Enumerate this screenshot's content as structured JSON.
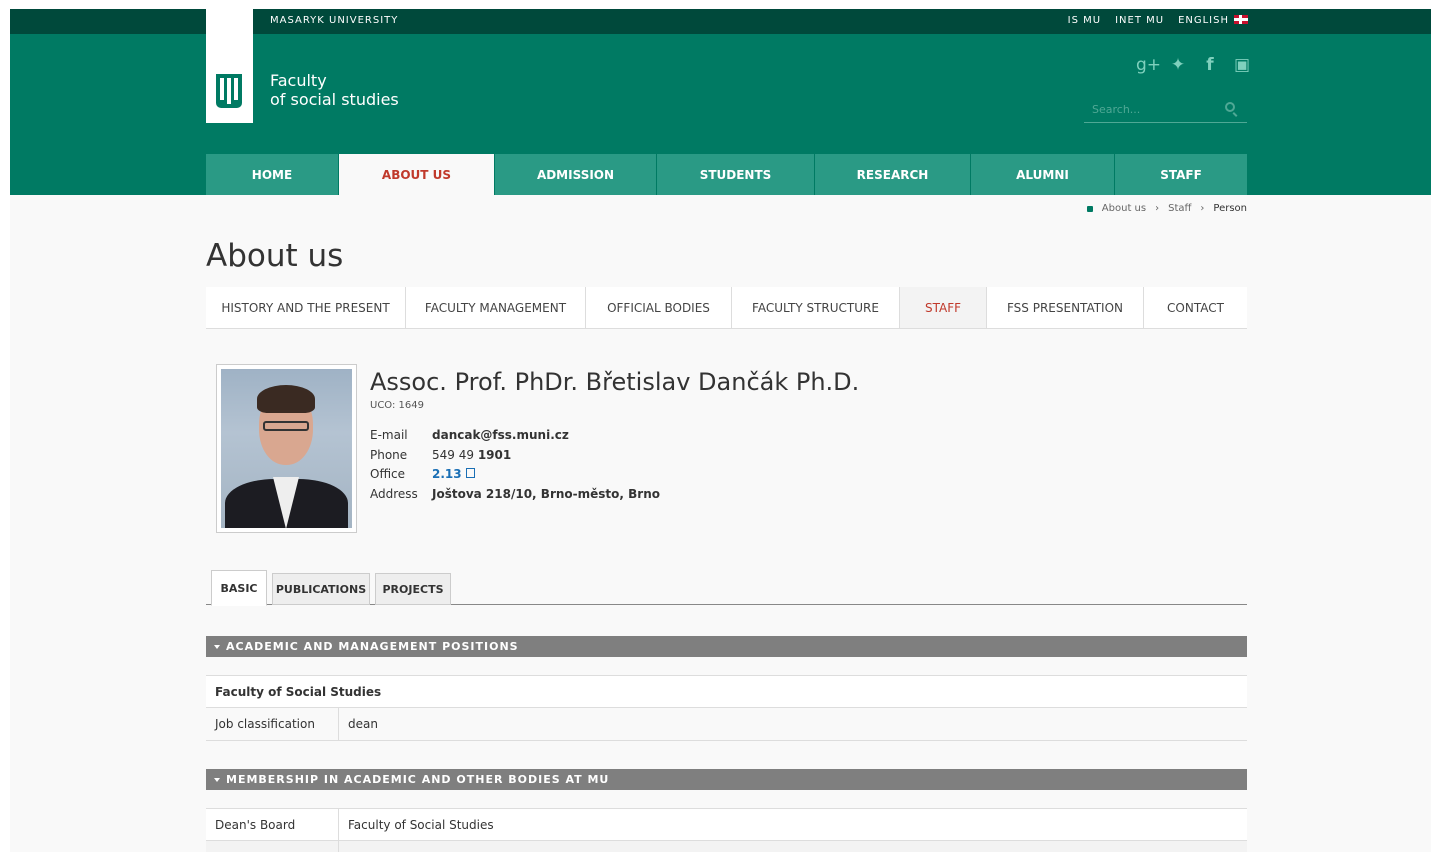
{
  "topbar": {
    "university": "MASARYK UNIVERSITY",
    "links": [
      "IS MU",
      "INET MU",
      "ENGLISH"
    ]
  },
  "header": {
    "faculty_line1": "Faculty",
    "faculty_line2": "of social studies",
    "search_placeholder": "Search..."
  },
  "social_icons": [
    "google-plus-icon",
    "twitter-icon",
    "facebook-icon",
    "youtube-icon"
  ],
  "main_nav": [
    "HOME",
    "ABOUT US",
    "ADMISSION",
    "STUDENTS",
    "RESEARCH",
    "ALUMNI",
    "STAFF"
  ],
  "breadcrumb": [
    "About us",
    "Staff",
    "Person"
  ],
  "page_title": "About us",
  "sub_nav": [
    "HISTORY AND THE PRESENT",
    "FACULTY MANAGEMENT",
    "OFFICIAL BODIES",
    "FACULTY STRUCTURE",
    "STAFF",
    "FSS PRESENTATION",
    "CONTACT"
  ],
  "person": {
    "name": "Assoc. Prof. PhDr. Břetislav Dančák Ph.D.",
    "uco": "UCO: 1649",
    "email_label": "E-mail",
    "email": "dancak@fss.muni.cz",
    "phone_label": "Phone",
    "phone_prefix": "549 49",
    "phone_ext": "1901",
    "office_label": "Office",
    "office": "2.13",
    "address_label": "Address",
    "address": "Joštova 218/10, Brno-město, Brno"
  },
  "tabs": [
    "BASIC",
    "PUBLICATIONS",
    "PROJECTS"
  ],
  "sections": {
    "academic": {
      "title": "ACADEMIC AND MANAGEMENT POSITIONS",
      "org": "Faculty of Social Studies",
      "rows": [
        {
          "key": "Job classification",
          "value": "dean"
        }
      ]
    },
    "membership": {
      "title": "MEMBERSHIP IN ACADEMIC AND OTHER BODIES AT MU",
      "rows": [
        {
          "key": "Dean's Board",
          "value": "Faculty of Social Studies"
        }
      ]
    }
  },
  "colors": {
    "brand": "#007a63",
    "brand_dark": "#00493b",
    "accent": "#c0392b",
    "link": "#1a6fb5"
  }
}
